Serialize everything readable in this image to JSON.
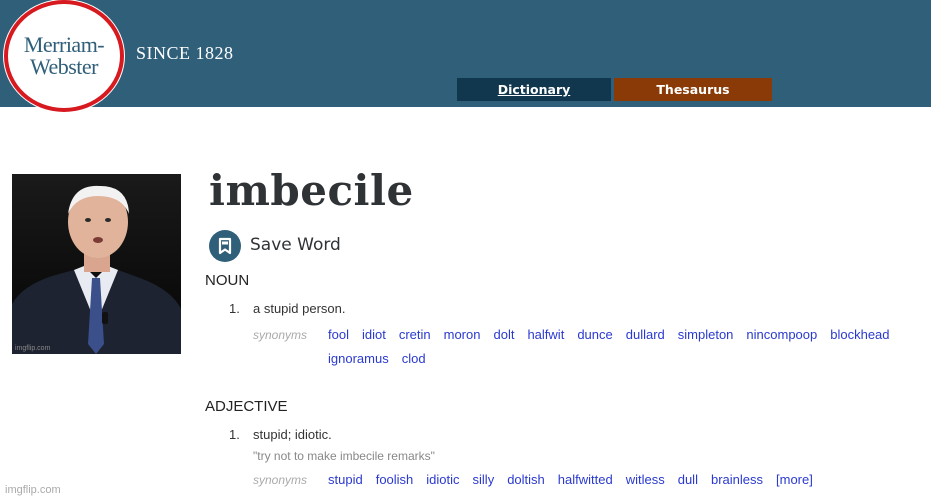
{
  "header": {
    "logo_line1": "Merriam-",
    "logo_line2": "Webster",
    "since": "SINCE 1828",
    "tabs": [
      {
        "label": "Dictionary"
      },
      {
        "label": "Thesaurus"
      }
    ],
    "colors": {
      "banner": "#305f7a",
      "dictionary_tab": "#10374e",
      "thesaurus_tab": "#8a3a06",
      "logo_ring": "#d71920"
    }
  },
  "entry": {
    "word": "imbecile",
    "save_label": "Save Word",
    "noun": {
      "pos": "NOUN",
      "number": "1.",
      "definition": "a stupid person.",
      "synonyms_label": "synonyms",
      "synonyms_line1": [
        "fool",
        "idiot",
        "cretin",
        "moron",
        "dolt",
        "halfwit",
        "dunce",
        "dullard",
        "simpleton",
        "nincompoop",
        "blockhead"
      ],
      "synonyms_line2": [
        "ignoramus",
        "clod"
      ]
    },
    "adjective": {
      "pos": "ADJECTIVE",
      "number": "1.",
      "definition": "stupid; idiotic.",
      "example": "\"try not to make imbecile remarks\"",
      "synonyms_label": "synonyms",
      "synonyms": [
        "stupid",
        "foolish",
        "idiotic",
        "silly",
        "doltish",
        "halfwitted",
        "witless",
        "dull",
        "brainless",
        "[more]"
      ]
    }
  },
  "photo": {
    "watermark": "imgflip.com"
  },
  "footer": {
    "watermark": "imgflip.com"
  }
}
